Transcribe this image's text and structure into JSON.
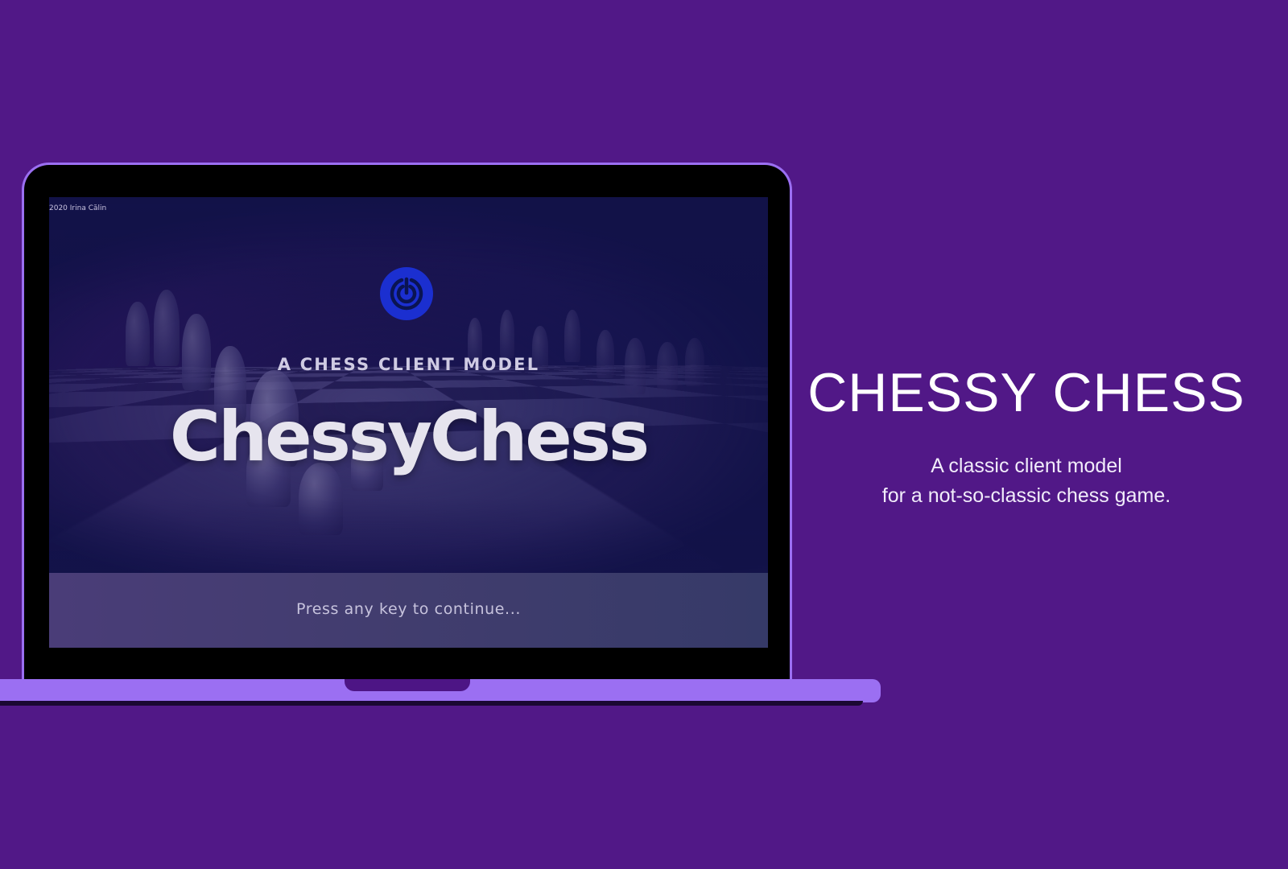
{
  "promo": {
    "title": "CHESSY CHESS",
    "subtitle_line1": "A classic client model",
    "subtitle_line2": "for a not-so-classic chess game."
  },
  "screen": {
    "copyright": "2020 Irina Călin",
    "kicker": "A CHESS CLIENT MODEL",
    "title": "ChessyChess",
    "continue_prompt": "Press any key to continue...",
    "logo_icon": "target-power-icon"
  },
  "colors": {
    "background": "#511887",
    "laptop_frame": "#9b6ff2",
    "logo_circle": "#1b2fd0",
    "screen_dark": "#161550"
  }
}
